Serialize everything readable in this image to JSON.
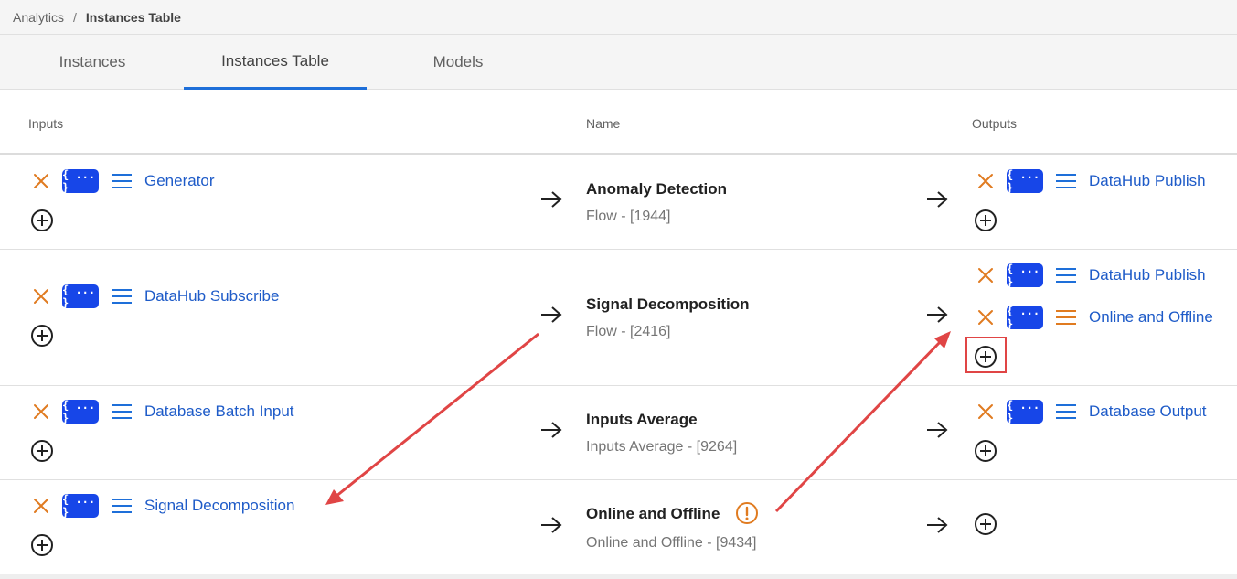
{
  "breadcrumb": {
    "root": "Analytics",
    "separator": "/",
    "current": "Instances Table"
  },
  "tabs": [
    {
      "label": "Instances",
      "active": false
    },
    {
      "label": "Instances Table",
      "active": true
    },
    {
      "label": "Models",
      "active": false
    }
  ],
  "table": {
    "headers": {
      "inputs": "Inputs",
      "name": "Name",
      "outputs": "Outputs"
    },
    "rows": [
      {
        "inputs": [
          {
            "label": "Generator"
          }
        ],
        "name": "Anomaly Detection",
        "subtitle": "Flow - [1944]",
        "outputs": [
          {
            "label": "DataHub Publish"
          }
        ]
      },
      {
        "inputs": [
          {
            "label": "DataHub Subscribe"
          }
        ],
        "name": "Signal Decomposition",
        "subtitle": "Flow - [2416]",
        "outputs": [
          {
            "label": "DataHub Publish"
          },
          {
            "label": "Online and Offline"
          }
        ]
      },
      {
        "inputs": [
          {
            "label": "Database Batch Input"
          }
        ],
        "name": "Inputs Average",
        "subtitle": "Inputs Average - [9264]",
        "outputs": [
          {
            "label": "Database Output"
          }
        ]
      },
      {
        "inputs": [
          {
            "label": "Signal Decomposition"
          }
        ],
        "name": "Online and Offline",
        "subtitle": "Online and Offline - [9434]",
        "outputs": []
      }
    ]
  },
  "json_button_label": "{ ... }",
  "colors": {
    "accent": "#1e6fd9",
    "json_button": "#1746e8",
    "link": "#1e5bc8",
    "remove_icon": "#e07b20",
    "menu_icon": "#1e6fd9",
    "menu_icon_warning": "#e07b20",
    "warning": "#e07b20",
    "annotation": "#e04545"
  }
}
